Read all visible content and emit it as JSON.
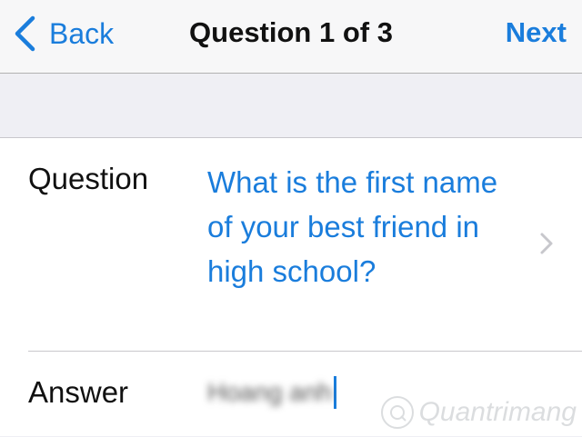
{
  "nav": {
    "back_label": "Back",
    "title": "Question 1 of 3",
    "next_label": "Next"
  },
  "form": {
    "question_label": "Question",
    "question_value": "What is the first name of your best friend in high school?",
    "answer_label": "Answer",
    "answer_value": "Hoang anh"
  },
  "watermark": {
    "text": "Quantrimang"
  },
  "colors": {
    "accent": "#1a7ddc",
    "background": "#efeff4",
    "separator": "#c8c7cc"
  }
}
